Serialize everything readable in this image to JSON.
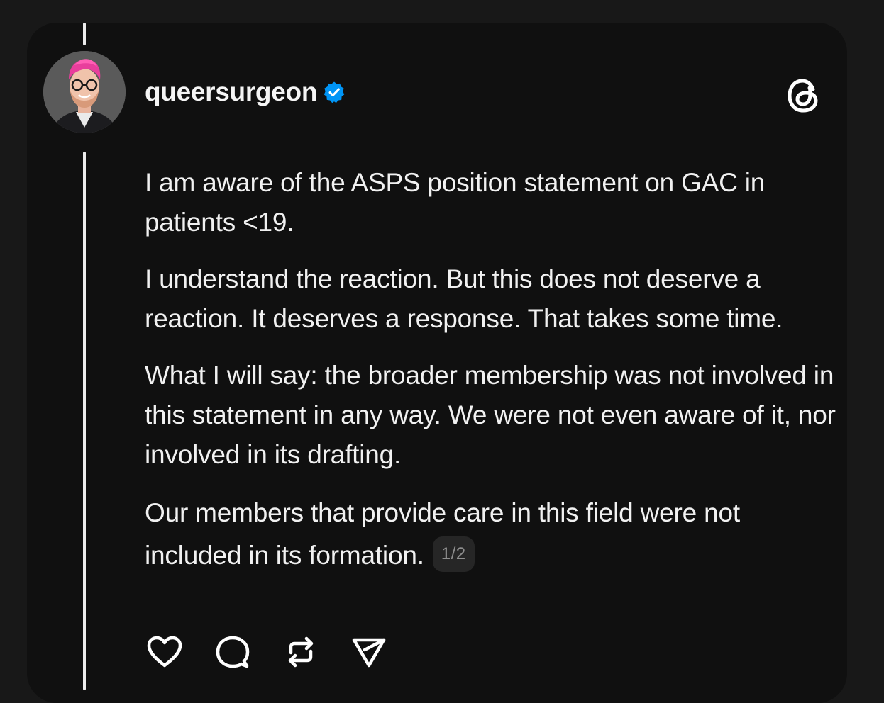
{
  "post": {
    "username": "queersurgeon",
    "verified": true,
    "paragraphs": [
      "I am aware of the ASPS position statement on GAC in patients <19.",
      "I understand the reaction. But this does not deserve a reaction. It deserves a response. That takes some time.",
      "What I will say: the broader membership was not involved in this statement in any way. We were not even aware of it, nor involved in its drafting.",
      "Our members that provide care in this field were not included in its formation."
    ],
    "page_indicator": "1/2"
  },
  "icons": {
    "verified": "verified-badge-icon",
    "app": "threads-logo-icon",
    "like": "heart-icon",
    "reply": "comment-icon",
    "repost": "repost-icon",
    "share": "send-icon"
  },
  "colors": {
    "background": "#181818",
    "card": "#101010",
    "text": "#f1f1f1",
    "verified": "#0095f6",
    "badge_bg": "#262626",
    "badge_text": "#8f8f8f"
  }
}
